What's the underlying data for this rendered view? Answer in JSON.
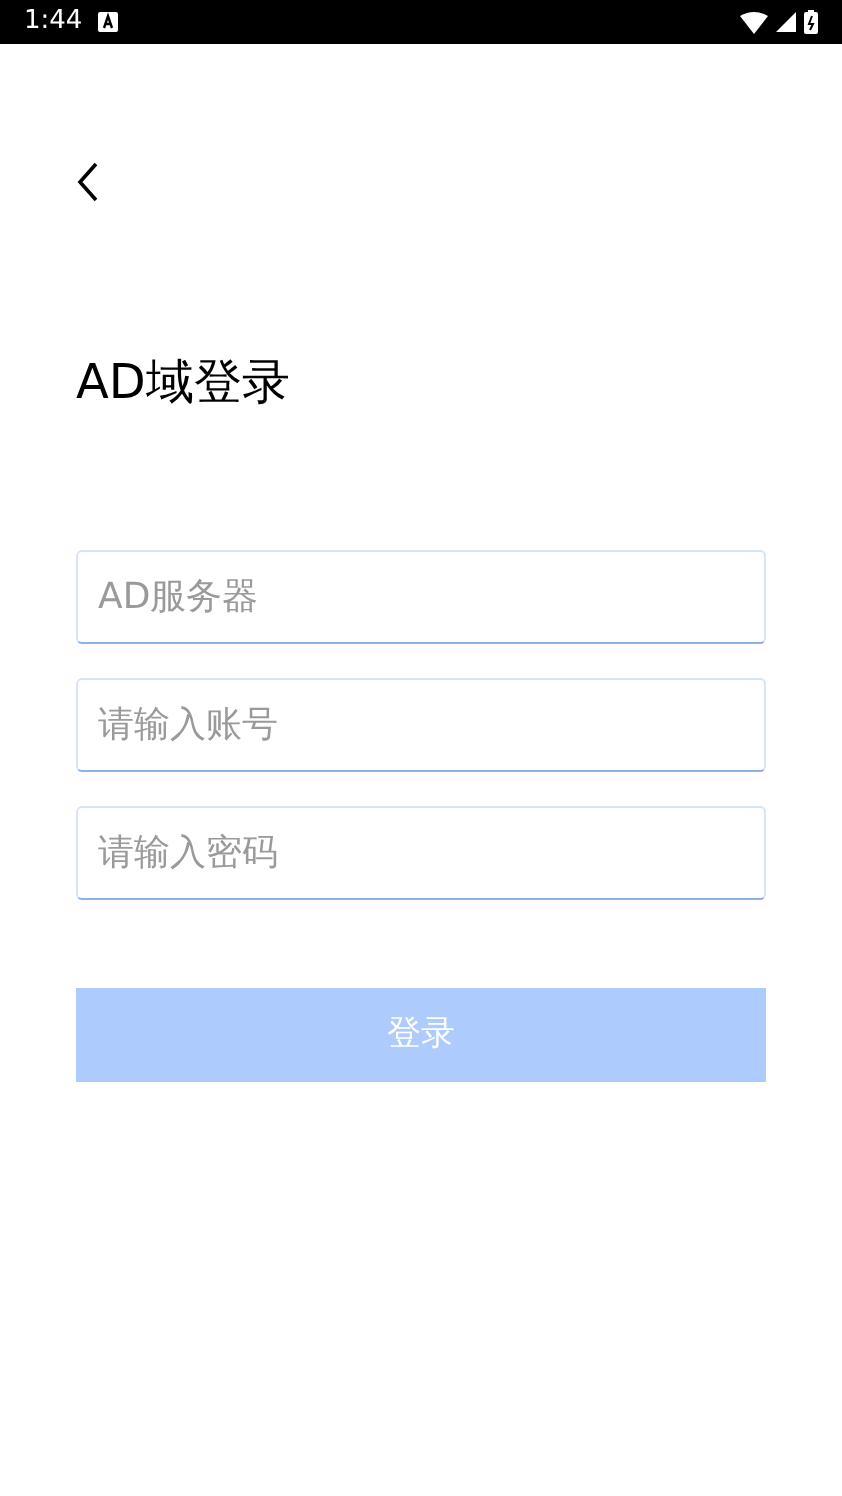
{
  "status_bar": {
    "time": "1:44"
  },
  "title": "AD域登录",
  "fields": [
    {
      "placeholder": "AD服务器"
    },
    {
      "placeholder": "请输入账号"
    },
    {
      "placeholder": "请输入密码"
    }
  ],
  "login_button": {
    "label": "登录",
    "disabled": true
  }
}
